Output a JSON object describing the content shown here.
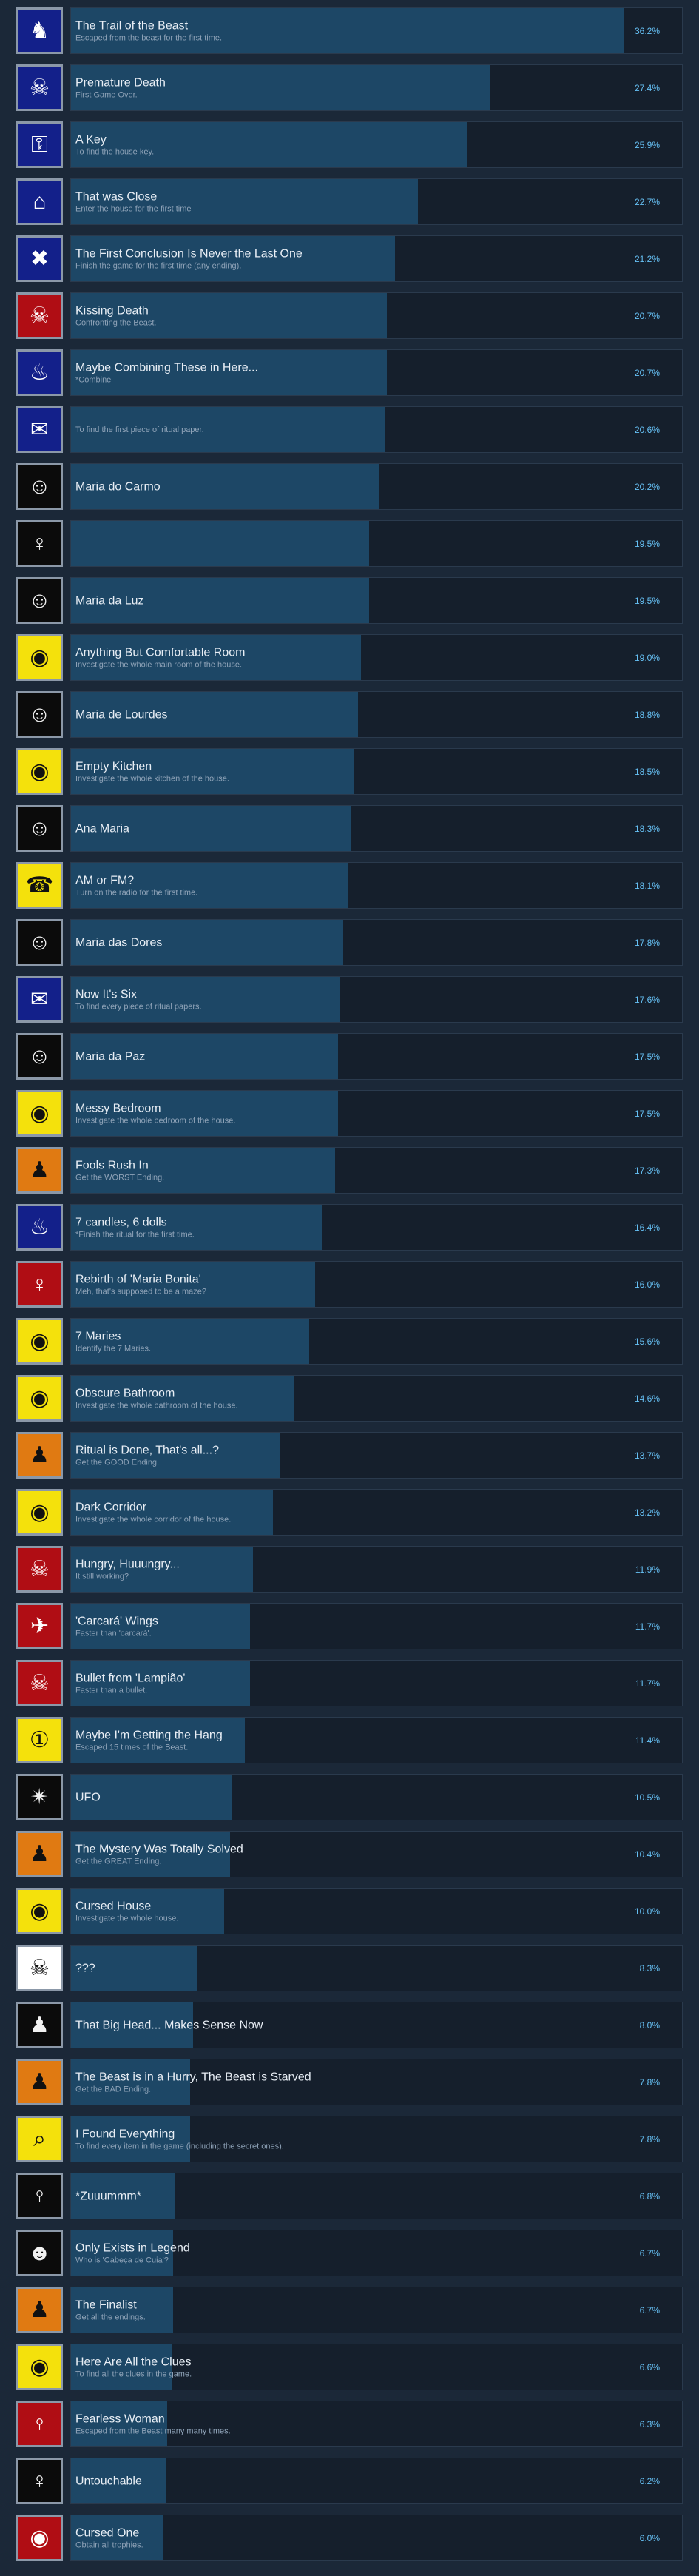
{
  "achievements": [
    {
      "title": "The Trail of the Beast",
      "description": "Escaped from the beast for the first time.",
      "percent": "36.2%",
      "value": 36.2,
      "icon": "beast-silhouette-icon",
      "theme": "blue",
      "glyph": "♞"
    },
    {
      "title": "Premature Death",
      "description": "First Game Over.",
      "percent": "27.4%",
      "value": 27.4,
      "icon": "bone-icon",
      "theme": "blue",
      "glyph": "☠"
    },
    {
      "title": "A Key",
      "description": "To find the house key.",
      "percent": "25.9%",
      "value": 25.9,
      "icon": "key-icon",
      "theme": "blue",
      "glyph": "⚿"
    },
    {
      "title": "That was Close",
      "description": "Enter the house for the first time",
      "percent": "22.7%",
      "value": 22.7,
      "icon": "house-icon",
      "theme": "blue",
      "glyph": "⌂"
    },
    {
      "title": "The First Conclusion Is Never the Last One",
      "description": "Finish the game for the first time (any ending).",
      "percent": "21.2%",
      "value": 21.2,
      "icon": "crossed-tools-icon",
      "theme": "blue",
      "glyph": "✖"
    },
    {
      "title": "Kissing Death",
      "description": "Confronting the Beast.",
      "percent": "20.7%",
      "value": 20.7,
      "icon": "beast-attack-icon",
      "theme": "red",
      "glyph": "☠"
    },
    {
      "title": "Maybe Combining These in Here...",
      "description": "*Combine",
      "percent": "20.7%",
      "value": 20.7,
      "icon": "candle-icon",
      "theme": "blue",
      "glyph": "♨"
    },
    {
      "title": "",
      "description": "To find the first piece of ritual paper.",
      "percent": "20.6%",
      "value": 20.6,
      "icon": "paper-icon",
      "theme": "blue",
      "glyph": "✉"
    },
    {
      "title": "Maria do Carmo",
      "description": "",
      "percent": "20.2%",
      "value": 20.2,
      "icon": "doll-face-icon",
      "theme": "black",
      "glyph": "☺"
    },
    {
      "title": "",
      "description": "",
      "percent": "19.5%",
      "value": 19.5,
      "icon": "figure-icon",
      "theme": "black",
      "glyph": "♀"
    },
    {
      "title": "Maria da Luz",
      "description": "",
      "percent": "19.5%",
      "value": 19.5,
      "icon": "doll-face-icon",
      "theme": "black",
      "glyph": "☺"
    },
    {
      "title": "Anything But Comfortable Room",
      "description": "Investigate the whole main room of the house.",
      "percent": "19.0%",
      "value": 19.0,
      "icon": "eye-icon",
      "theme": "yellow",
      "glyph": "◉"
    },
    {
      "title": "Maria de Lourdes",
      "description": "",
      "percent": "18.8%",
      "value": 18.8,
      "icon": "doll-face-icon",
      "theme": "black",
      "glyph": "☺"
    },
    {
      "title": "Empty Kitchen",
      "description": "Investigate the whole kitchen of the house.",
      "percent": "18.5%",
      "value": 18.5,
      "icon": "eye-icon",
      "theme": "yellow",
      "glyph": "◉"
    },
    {
      "title": "Ana Maria",
      "description": "",
      "percent": "18.3%",
      "value": 18.3,
      "icon": "doll-face-icon",
      "theme": "black",
      "glyph": "☺"
    },
    {
      "title": "AM or FM?",
      "description": "Turn on the radio for the first time.",
      "percent": "18.1%",
      "value": 18.1,
      "icon": "radio-icon",
      "theme": "yellow",
      "glyph": "☎"
    },
    {
      "title": "Maria das Dores",
      "description": "",
      "percent": "17.8%",
      "value": 17.8,
      "icon": "doll-face-icon",
      "theme": "black",
      "glyph": "☺"
    },
    {
      "title": "Now It's Six",
      "description": "To find every piece of ritual papers.",
      "percent": "17.6%",
      "value": 17.6,
      "icon": "papers-icon",
      "theme": "blue",
      "glyph": "✉"
    },
    {
      "title": "Maria da Paz",
      "description": "",
      "percent": "17.5%",
      "value": 17.5,
      "icon": "doll-face-icon",
      "theme": "black",
      "glyph": "☺"
    },
    {
      "title": "Messy Bedroom",
      "description": "Investigate the whole bedroom of the house.",
      "percent": "17.5%",
      "value": 17.5,
      "icon": "eye-icon",
      "theme": "yellow",
      "glyph": "◉"
    },
    {
      "title": "Fools Rush In",
      "description": "Get the WORST Ending.",
      "percent": "17.3%",
      "value": 17.3,
      "icon": "figure-icon",
      "theme": "orange",
      "glyph": "♟"
    },
    {
      "title": "7 candles, 6 dolls",
      "description": "*Finish the ritual for the first time.",
      "percent": "16.4%",
      "value": 16.4,
      "icon": "candle-icon",
      "theme": "blue",
      "glyph": "♨"
    },
    {
      "title": "Rebirth of 'Maria Bonita'",
      "description": "Meh, that's supposed to be a maze?",
      "percent": "16.0%",
      "value": 16.0,
      "icon": "figure-icon",
      "theme": "red",
      "glyph": "♀"
    },
    {
      "title": "7 Maries",
      "description": "Identify the 7 Maries.",
      "percent": "15.6%",
      "value": 15.6,
      "icon": "eyes-icon",
      "theme": "yellow",
      "glyph": "◉"
    },
    {
      "title": "Obscure Bathroom",
      "description": "Investigate the whole bathroom of the house.",
      "percent": "14.6%",
      "value": 14.6,
      "icon": "eye-icon",
      "theme": "yellow",
      "glyph": "◉"
    },
    {
      "title": "Ritual is Done, That's all...?",
      "description": "Get the GOOD Ending.",
      "percent": "13.7%",
      "value": 13.7,
      "icon": "figure-icon",
      "theme": "orange",
      "glyph": "♟"
    },
    {
      "title": "Dark Corridor",
      "description": "Investigate the whole corridor of the house.",
      "percent": "13.2%",
      "value": 13.2,
      "icon": "eye-icon",
      "theme": "yellow",
      "glyph": "◉"
    },
    {
      "title": "Hungry, Huuungry...",
      "description": "It still working?",
      "percent": "11.9%",
      "value": 11.9,
      "icon": "beast-mouth-icon",
      "theme": "red",
      "glyph": "☠"
    },
    {
      "title": "'Carcará' Wings",
      "description": "Faster than 'carcará'.",
      "percent": "11.7%",
      "value": 11.7,
      "icon": "wings-icon",
      "theme": "red",
      "glyph": "✈"
    },
    {
      "title": "Bullet from 'Lampião'",
      "description": "Faster than a bullet.",
      "percent": "11.7%",
      "value": 11.7,
      "icon": "bullet-icon",
      "theme": "red",
      "glyph": "☠"
    },
    {
      "title": "Maybe I'm Getting the Hang",
      "description": "Escaped 15 times of the Beast.",
      "percent": "11.4%",
      "value": 11.4,
      "icon": "number-15-icon",
      "theme": "yellow",
      "glyph": "①"
    },
    {
      "title": "UFO",
      "description": "",
      "percent": "10.5%",
      "value": 10.5,
      "icon": "stars-icon",
      "theme": "black",
      "glyph": "✴"
    },
    {
      "title": "The Mystery Was Totally Solved",
      "description": "Get the GREAT Ending.",
      "percent": "10.4%",
      "value": 10.4,
      "icon": "figure-icon",
      "theme": "orange",
      "glyph": "♟"
    },
    {
      "title": "Cursed House",
      "description": "Investigate the whole house.",
      "percent": "10.0%",
      "value": 10.0,
      "icon": "eye-icon",
      "theme": "yellow",
      "glyph": "◉"
    },
    {
      "title": "???",
      "description": "",
      "percent": "8.3%",
      "value": 8.3,
      "icon": "skull-icon",
      "theme": "white",
      "glyph": "☠"
    },
    {
      "title": "That Big Head... Makes Sense Now",
      "description": "",
      "percent": "8.0%",
      "value": 8.0,
      "icon": "figure-icon",
      "theme": "black",
      "glyph": "♟"
    },
    {
      "title": "The Beast is in a Hurry, The Beast is Starved",
      "description": "Get the BAD Ending.",
      "percent": "7.8%",
      "value": 7.8,
      "icon": "figure-icon",
      "theme": "orange",
      "glyph": "♟"
    },
    {
      "title": "I Found Everything",
      "description": "To find every item in the game (including the secret ones).",
      "percent": "7.8%",
      "value": 7.8,
      "icon": "magnifier-icon",
      "theme": "yellow",
      "glyph": "⌕"
    },
    {
      "title": "*Zuuummm*",
      "description": "",
      "percent": "6.8%",
      "value": 6.8,
      "icon": "figure-icon",
      "theme": "black",
      "glyph": "♀"
    },
    {
      "title": "Only Exists in Legend",
      "description": "Who is 'Cabeça de Cuia'?",
      "percent": "6.7%",
      "value": 6.7,
      "icon": "head-icon",
      "theme": "black",
      "glyph": "☻"
    },
    {
      "title": "The Finalist",
      "description": "Get all the endings.",
      "percent": "6.7%",
      "value": 6.7,
      "icon": "figure-icon",
      "theme": "orange",
      "glyph": "♟"
    },
    {
      "title": "Here Are All the Clues",
      "description": "To find all the clues in the game.",
      "percent": "6.6%",
      "value": 6.6,
      "icon": "eye-icon",
      "theme": "yellow",
      "glyph": "◉"
    },
    {
      "title": "Fearless Woman",
      "description": "Escaped from the Beast many many times.",
      "percent": "6.3%",
      "value": 6.3,
      "icon": "number-70-icon",
      "theme": "red",
      "glyph": "♀"
    },
    {
      "title": "Untouchable",
      "description": "",
      "percent": "6.2%",
      "value": 6.2,
      "icon": "number-100-icon",
      "theme": "black",
      "glyph": "♀"
    },
    {
      "title": "Cursed One",
      "description": "Obtain all trophies.",
      "percent": "6.0%",
      "value": 6.0,
      "icon": "eye-icon",
      "theme": "red",
      "glyph": "◉"
    }
  ],
  "bar_scale_max": 40.0
}
